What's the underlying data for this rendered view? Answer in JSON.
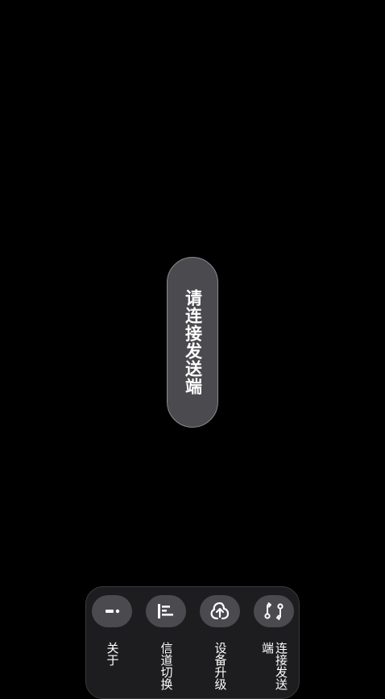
{
  "toast": {
    "message": "请连接发送端"
  },
  "controls": [
    {
      "icon": "info-icon",
      "label": "关于"
    },
    {
      "icon": "channel-bars-icon",
      "label": "信道切换"
    },
    {
      "icon": "cloud-upgrade-icon",
      "label": "设备升级"
    },
    {
      "icon": "connect-swap-icon",
      "label": "连接发送端"
    }
  ],
  "colors": {
    "background": "#000000",
    "pill": "#4a4a4f",
    "panel": "#1d1d1f",
    "text": "#ffffff"
  }
}
